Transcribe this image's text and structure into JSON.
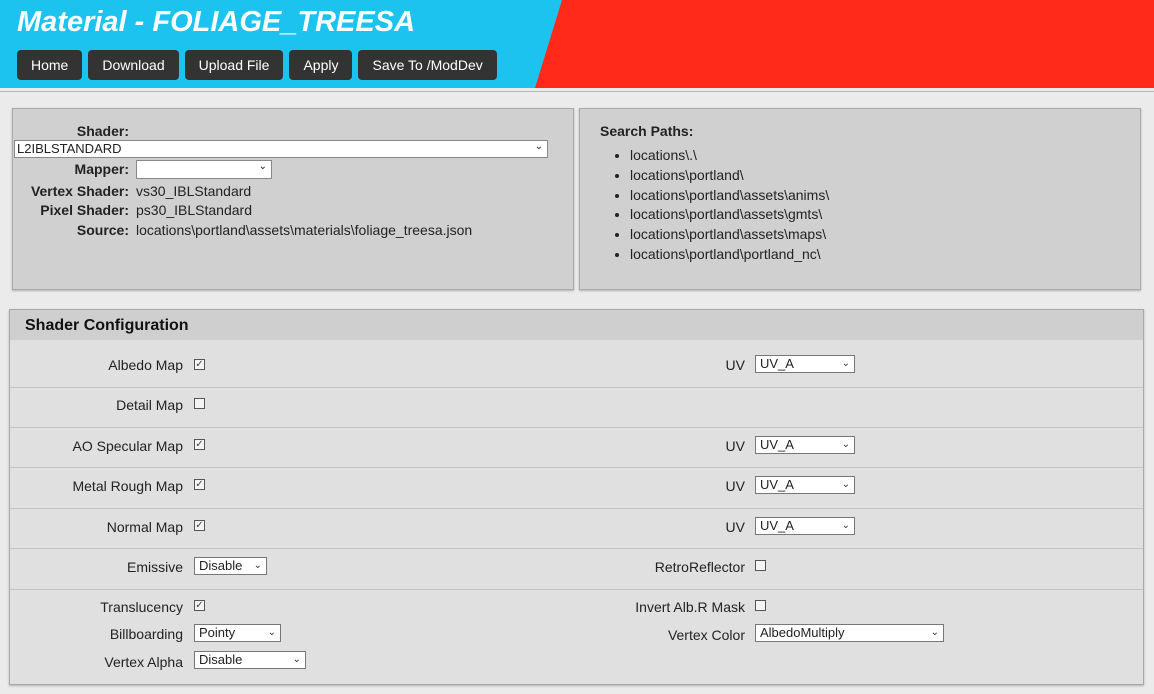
{
  "header": {
    "title": "Material - FOLIAGE_TREESA",
    "colors": {
      "left": "#1cc3ee",
      "right": "#ff2a1a"
    },
    "nav": [
      "Home",
      "Download",
      "Upload File",
      "Apply",
      "Save To /ModDev"
    ]
  },
  "shader_panel": {
    "shader_label": "Shader:",
    "shader_value": "L2IBLSTANDARD",
    "mapper_label": "Mapper:",
    "mapper_value": "",
    "vertex_label": "Vertex Shader:",
    "vertex_value": "vs30_IBLStandard",
    "pixel_label": "Pixel Shader:",
    "pixel_value": "ps30_IBLStandard",
    "source_label": "Source:",
    "source_value": "locations\\portland\\assets\\materials\\foliage_treesa.json"
  },
  "search_panel": {
    "title": "Search Paths:",
    "paths": [
      "locations\\.\\",
      "locations\\portland\\",
      "locations\\portland\\assets\\anims\\",
      "locations\\portland\\assets\\gmts\\",
      "locations\\portland\\assets\\maps\\",
      "locations\\portland\\portland_nc\\"
    ]
  },
  "config": {
    "title": "Shader Configuration",
    "albedo": {
      "label": "Albedo Map",
      "checked": true,
      "uv_label": "UV",
      "uv": "UV_A"
    },
    "detail": {
      "label": "Detail Map",
      "checked": false
    },
    "ao": {
      "label": "AO Specular Map",
      "checked": true,
      "uv_label": "UV",
      "uv": "UV_A"
    },
    "metal": {
      "label": "Metal Rough Map",
      "checked": true,
      "uv_label": "UV",
      "uv": "UV_A"
    },
    "normal": {
      "label": "Normal Map",
      "checked": true,
      "uv_label": "UV",
      "uv": "UV_A"
    },
    "emissive": {
      "label": "Emissive",
      "value": "Disable"
    },
    "retro": {
      "label": "RetroReflector",
      "checked": false
    },
    "translucency": {
      "label": "Translucency",
      "checked": true
    },
    "invert": {
      "label": "Invert Alb.R Mask",
      "checked": false
    },
    "billboarding": {
      "label": "Billboarding",
      "value": "Pointy"
    },
    "vertex_color": {
      "label": "Vertex Color",
      "value": "AlbedoMultiply"
    },
    "vertex_alpha": {
      "label": "Vertex Alpha",
      "value": "Disable"
    }
  }
}
